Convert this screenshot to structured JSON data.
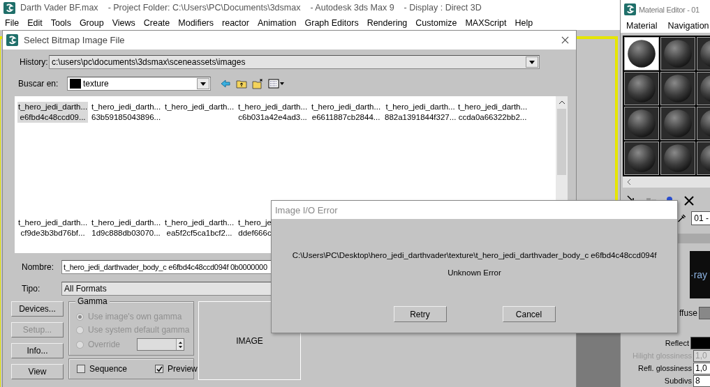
{
  "main_window": {
    "title_parts": [
      "Darth Vader BF.max",
      "- Project Folder: C:\\Users\\PC\\Documents\\3dsmax",
      "- Autodesk 3ds Max 9",
      "- Display : Direct 3D"
    ],
    "menu": [
      "File",
      "Edit",
      "Tools",
      "Group",
      "Views",
      "Create",
      "Modifiers",
      "reactor",
      "Animation",
      "Graph Editors",
      "Rendering",
      "Customize",
      "MAXScript",
      "Help"
    ]
  },
  "bitmap_dialog": {
    "title": "Select Bitmap Image File",
    "history_label": "History:",
    "history": "c:\\users\\pc\\documents\\3dsmax\\sceneassets\\images",
    "look_in_label": "Buscar en:",
    "look_in": "texture",
    "files": [
      {
        "name": "t_hero_jedi_darth...",
        "detail": "e6fbd4c48ccd09...",
        "selected": true
      },
      {
        "name": "t_hero_jedi_darth...",
        "detail": "63b59185043896...",
        "selected": false
      },
      {
        "name": "t_hero_jedi_darth...",
        "selected": false
      },
      {
        "name": "t_hero_jedi_darth...",
        "detail": "c6b031a42e4ad3...",
        "selected": false
      },
      {
        "name": "t_hero_jedi_darth...",
        "detail": "e6611887cb2844...",
        "selected": false
      },
      {
        "name": "t_hero_jedi_darth...",
        "detail": "882a1391844f327...",
        "selected": false
      },
      {
        "name": "t_hero_jedi_darth...",
        "detail": "ccda0a66322bb2...",
        "selected": false
      },
      {
        "name": "t_hero_jedi_darth...",
        "detail": "cf9de3b3bd76bf...",
        "selected": false
      },
      {
        "name": "t_hero_jedi_darth...",
        "detail": "1d9c888db03070...",
        "selected": false
      },
      {
        "name": "t_hero_jedi_darth...",
        "detail": "ea5f2cf5ca1bcf2...",
        "selected": false
      },
      {
        "name": "t_hero_je",
        "detail": "ddef666c",
        "selected": false
      }
    ],
    "name_label": "Nombre:",
    "name_value": "t_hero_jedi_darthvader_body_c e6fbd4c48ccd094f 0b0000000",
    "type_label": "Tipo:",
    "type_value": "All Formats",
    "side_buttons": [
      {
        "label": "Devices...",
        "disabled": false
      },
      {
        "label": "Setup...",
        "disabled": true
      },
      {
        "label": "Info...",
        "disabled": false
      },
      {
        "label": "View",
        "disabled": false
      }
    ],
    "gamma": {
      "title": "Gamma",
      "disabled": true,
      "options": [
        {
          "label": "Use image's own gamma",
          "selected": true
        },
        {
          "label": "Use system default gamma",
          "selected": false
        },
        {
          "label": "Override",
          "selected": false
        }
      ]
    },
    "checkboxes": [
      {
        "label": "Sequence",
        "checked": false
      },
      {
        "label": "Preview",
        "checked": true
      }
    ],
    "preview_label": "IMAGE"
  },
  "error_dialog": {
    "title": "Image I/O Error",
    "message": "C:\\Users\\PC\\Desktop\\hero_jedi_darthvader\\texture\\t_hero_jedi_darthvader_body_c e6fbd4c48ccd094f",
    "detail": "Unknown Error",
    "buttons": [
      "Retry",
      "Cancel"
    ]
  },
  "material_editor": {
    "title": "Material Editor - 01",
    "menu": [
      "Material",
      "Navigation"
    ],
    "slots": [
      {
        "selected": true
      },
      {
        "selected": false
      },
      {
        "selected": false
      },
      {
        "selected": false
      },
      {
        "selected": false
      },
      {
        "selected": false
      },
      {
        "selected": false
      },
      {
        "selected": false
      },
      {
        "selected": false
      },
      {
        "selected": false
      },
      {
        "selected": false
      },
      {
        "selected": false
      }
    ],
    "slot_name": "01 -",
    "logo_text": "·ray",
    "diffuse_label": "ffuse",
    "params": [
      {
        "kind": "swatch",
        "label": "Reflect",
        "disabled": false
      },
      {
        "kind": "number",
        "label": "Hilight glossiness",
        "value": "1,0",
        "disabled": true
      },
      {
        "kind": "number",
        "label": "Refl. glossiness",
        "value": "1,0",
        "disabled": false
      },
      {
        "kind": "number",
        "label": "Subdivs",
        "value": "8",
        "disabled": false
      }
    ]
  }
}
